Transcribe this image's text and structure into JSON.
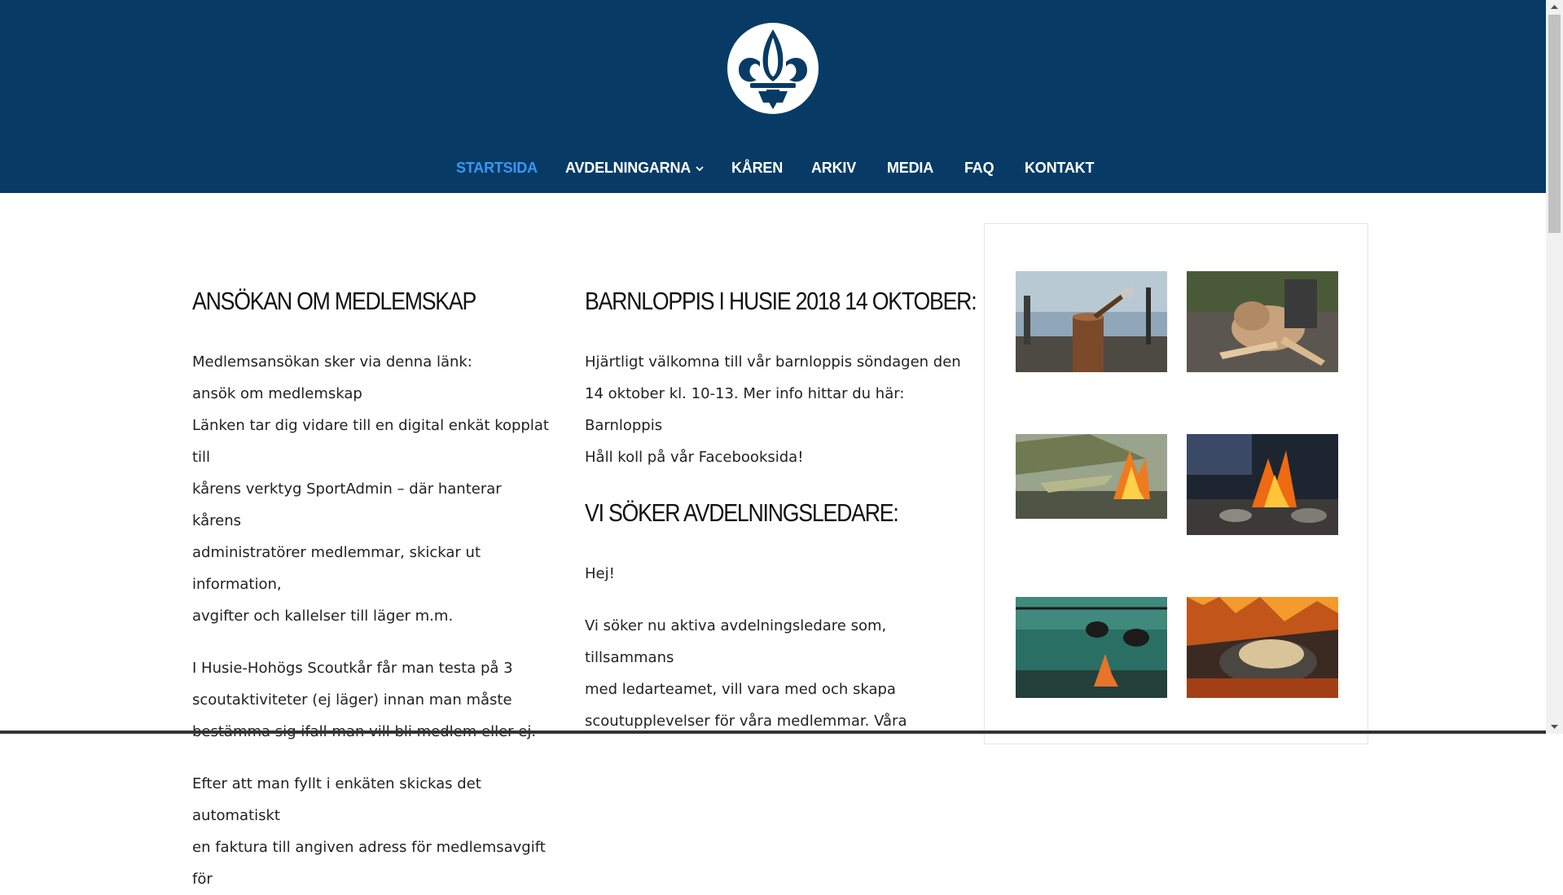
{
  "colors": {
    "header_bg": "#073b66",
    "nav_active": "#3b96f2",
    "nav_text": "#ffffff"
  },
  "logo": {
    "icon": "fleur-de-lis-icon"
  },
  "nav": {
    "items": [
      {
        "label": "STARTSIDA",
        "active": true
      },
      {
        "label": "AVDELNINGARNA",
        "has_dropdown": true
      },
      {
        "label": "KÅREN"
      },
      {
        "label": "ARKIV"
      },
      {
        "label": "MEDIA"
      },
      {
        "label": "FAQ"
      },
      {
        "label": "KONTAKT"
      }
    ]
  },
  "col1": {
    "heading": "ANSÖKAN OM MEDLEMSKAP",
    "lines1": [
      "Medlemsansökan sker via denna länk:",
      "ansök om medlemskap",
      "Länken tar dig vidare till en digital enkät kopplat till",
      "kårens verktyg SportAdmin – där hanterar kårens",
      "administratörer medlemmar, skickar ut information,",
      "avgifter och kallelser till läger m.m."
    ],
    "lines2": [
      "I Husie-Hohögs Scoutkår får man testa på 3",
      "scoutaktiviteter (ej läger) innan man måste",
      "bestämma sig ifall man vill bli medlem eller ej."
    ],
    "lines3": [
      "Efter att man fyllt i enkäten skickas det automatiskt",
      "en faktura till angiven adress för medlemsavgift för"
    ]
  },
  "col2": {
    "heading1": "BARNLOPPIS I HUSIE 2018 14 OKTOBER:",
    "lines1": [
      "Hjärtligt välkomna till vår barnloppis söndagen den",
      "14 oktober kl. 10-13. Mer info hittar du här:",
      "Barnloppis",
      "Håll koll på vår Facebooksida!"
    ],
    "heading2": "VI SÖKER AVDELNINGSLEDARE:",
    "lines2": [
      "Hej!"
    ],
    "lines3": [
      "Vi söker nu aktiva avdelningsledare som, tillsammans",
      "med ledarteamet, vill vara med och skapa",
      "scoutupplevelser för våra medlemmar. Våra"
    ]
  },
  "gallery": {
    "images": [
      "axe-in-log",
      "whittling-wood",
      "campfire-tent",
      "night-campfire",
      "cooking-pots",
      "bread-on-fire"
    ]
  }
}
